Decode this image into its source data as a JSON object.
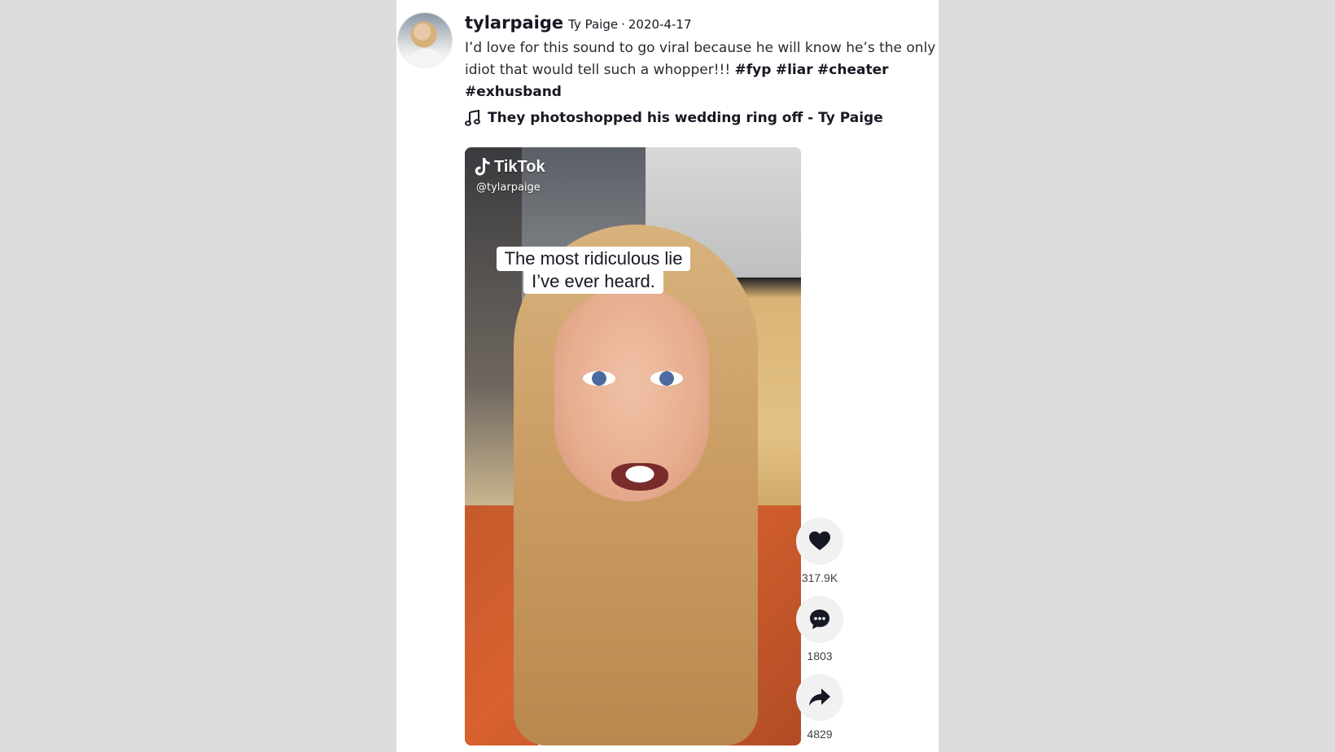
{
  "post": {
    "username": "tylarpaige",
    "nickname": "Ty Paige",
    "separator": "·",
    "date": "2020-4-17",
    "caption_text": "I’d love for this sound to go viral because he will know he’s the only idiot that would tell such a whopper!!!",
    "hashtags": [
      "#fyp",
      "#liar",
      "#cheater",
      "#exhusband"
    ],
    "music": "They photoshopped his wedding ring off - Ty Paige",
    "avatar_icon": "user-avatar"
  },
  "video": {
    "watermark_brand": "TikTok",
    "watermark_handle": "@tylarpaige",
    "overlay_lines": [
      "The most ridiculous lie",
      "I’ve ever heard."
    ]
  },
  "actions": {
    "like_icon": "heart-icon",
    "like_count": "317.9K",
    "comment_icon": "comment-icon",
    "comment_count": "1803",
    "share_icon": "share-icon",
    "share_count": "4829"
  },
  "colors": {
    "page_background": "#dcdcdc",
    "card_background": "#ffffff",
    "action_button": "#f1f1f2",
    "text_primary": "#161823"
  }
}
